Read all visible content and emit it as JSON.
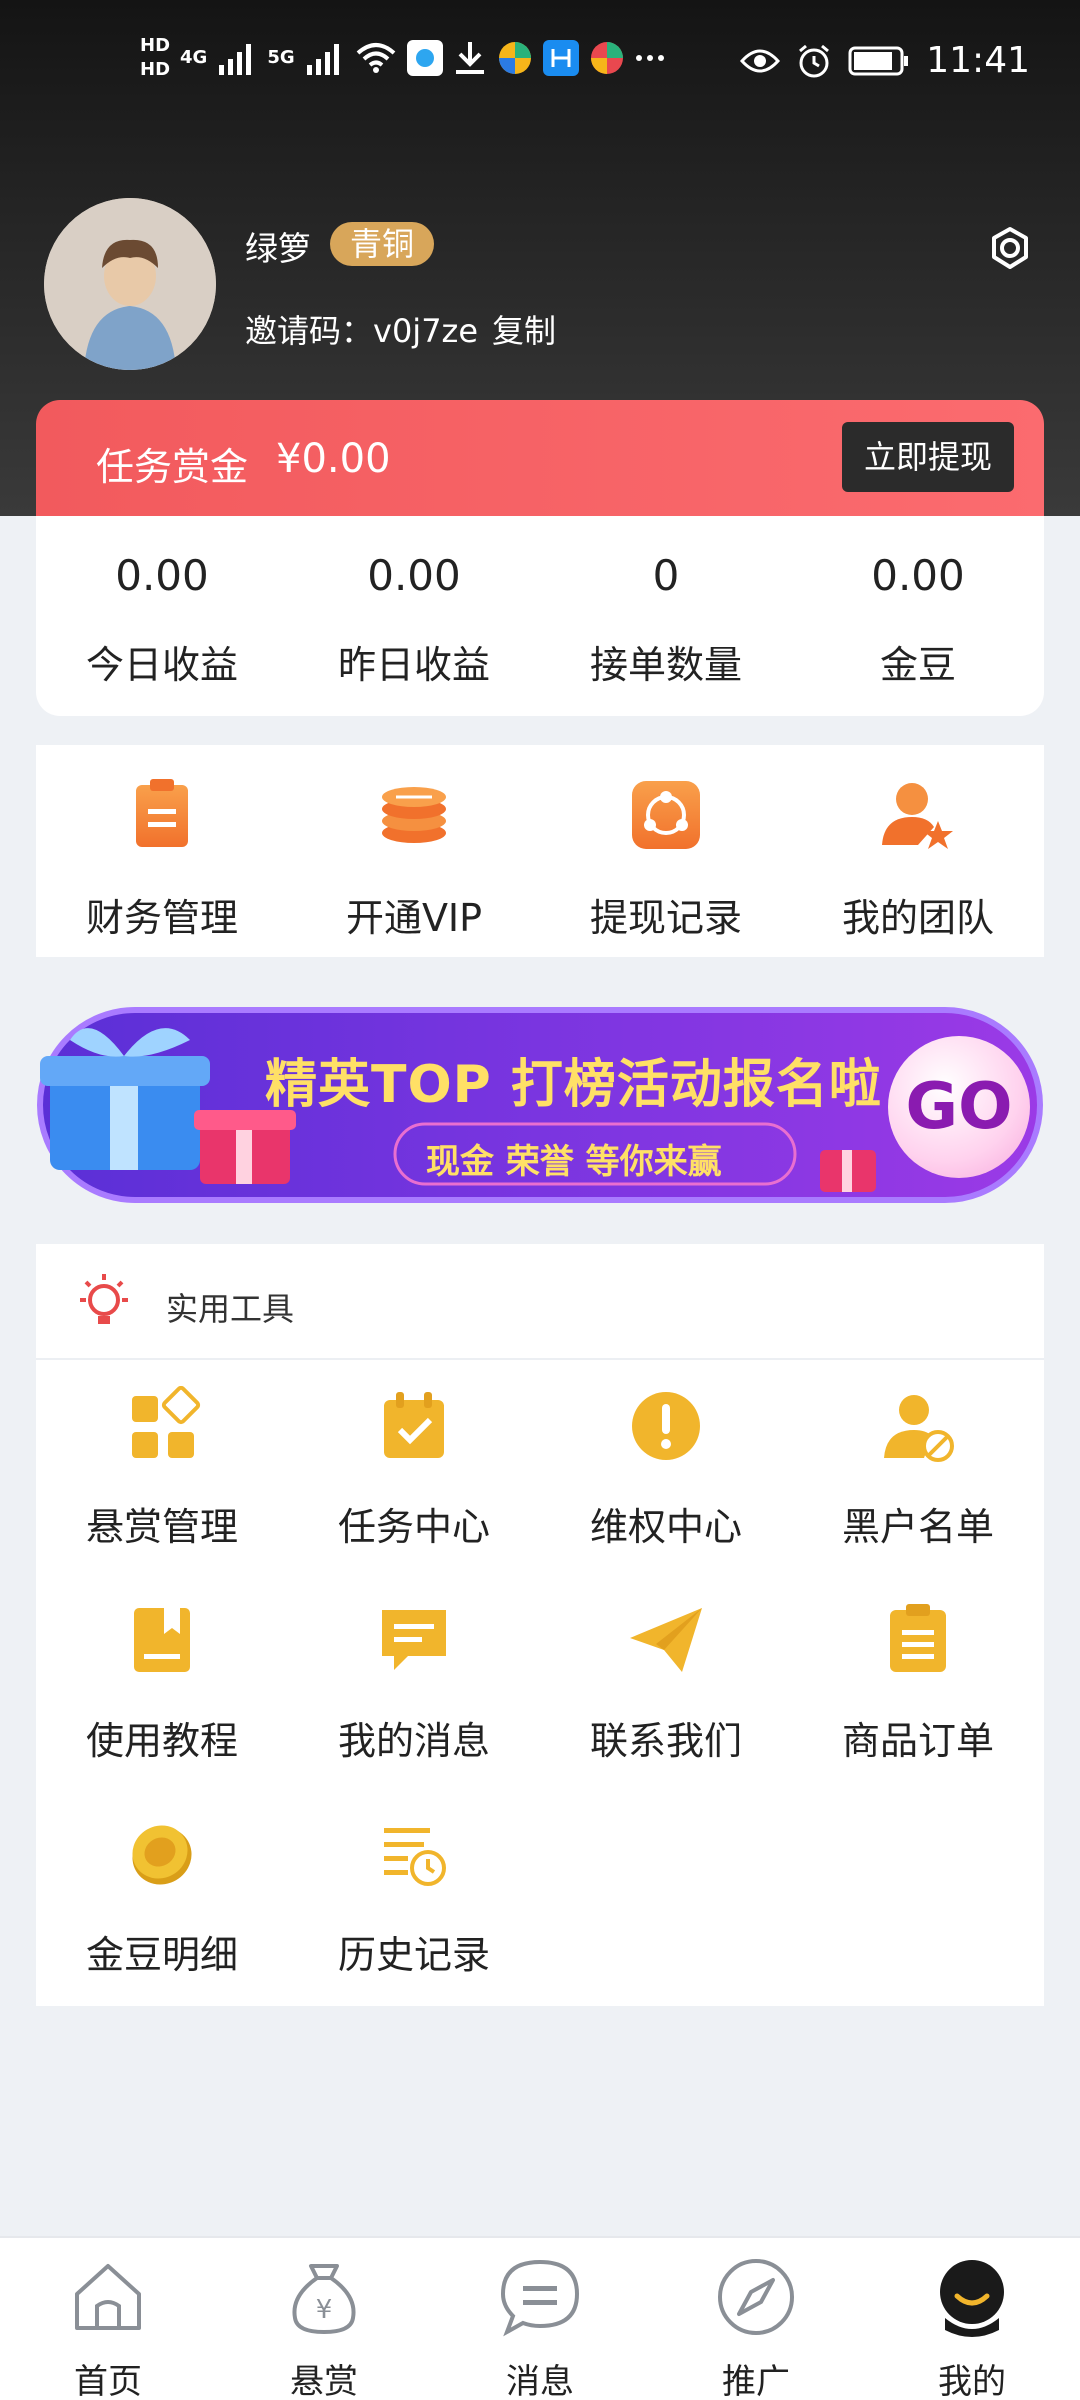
{
  "status_bar": {
    "left_text_1": "HD",
    "left_text_2": "4G",
    "left_text_3": "5G",
    "time": "11:41"
  },
  "profile": {
    "name": "绿箩",
    "level_badge": "青铜",
    "invite_label": "邀请码：v0j7ze",
    "copy_label": "复制"
  },
  "reward": {
    "label": "任务赏金",
    "amount": "¥0.00",
    "withdraw_label": "立即提现"
  },
  "stats": [
    {
      "value": "0.00",
      "label": "今日收益"
    },
    {
      "value": "0.00",
      "label": "昨日收益"
    },
    {
      "value": "0",
      "label": "接单数量"
    },
    {
      "value": "0.00",
      "label": "金豆"
    }
  ],
  "quick_menu": [
    {
      "label": "财务管理",
      "icon": "clipboard-icon"
    },
    {
      "label": "开通VIP",
      "icon": "coin-stack-icon"
    },
    {
      "label": "提现记录",
      "icon": "share-icon"
    },
    {
      "label": "我的团队",
      "icon": "user-star-icon"
    }
  ],
  "banner": {
    "title": "精英TOP 打榜活动报名啦",
    "subtitle": "现金 荣誉 等你来赢",
    "go_label": "GO"
  },
  "tools": {
    "title": "实用工具",
    "items": [
      {
        "label": "悬赏管理",
        "icon": "grid-icon"
      },
      {
        "label": "任务中心",
        "icon": "calendar-check-icon"
      },
      {
        "label": "维权中心",
        "icon": "exclamation-icon"
      },
      {
        "label": "黑户名单",
        "icon": "user-block-icon"
      },
      {
        "label": "使用教程",
        "icon": "book-icon"
      },
      {
        "label": "我的消息",
        "icon": "message-icon"
      },
      {
        "label": "联系我们",
        "icon": "paper-plane-icon"
      },
      {
        "label": "商品订单",
        "icon": "order-icon"
      },
      {
        "label": "金豆明细",
        "icon": "coin-icon"
      },
      {
        "label": "历史记录",
        "icon": "history-icon"
      }
    ]
  },
  "tabbar": [
    {
      "label": "首页",
      "icon": "home-icon"
    },
    {
      "label": "悬赏",
      "icon": "money-bag-icon"
    },
    {
      "label": "消息",
      "icon": "chat-icon"
    },
    {
      "label": "推广",
      "icon": "compass-icon"
    },
    {
      "label": "我的",
      "icon": "profile-icon"
    }
  ],
  "colors": {
    "reward_red": "#f25a5d",
    "icon_orange": "#f3813a",
    "tool_gold": "#f1b52c",
    "badge_gold": "#d8a65a",
    "banner_purple": "#6f2fd8"
  }
}
